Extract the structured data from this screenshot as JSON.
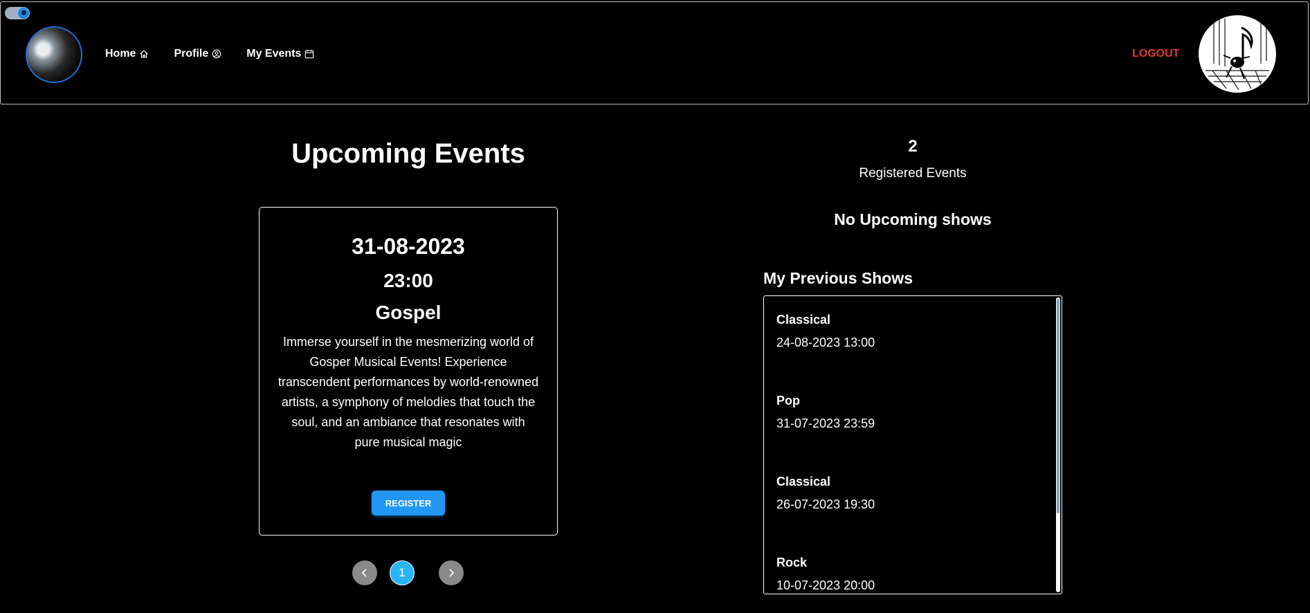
{
  "header": {
    "nav": [
      {
        "label": "Home",
        "icon": "home-icon"
      },
      {
        "label": "Profile",
        "icon": "user-circle-icon"
      },
      {
        "label": "My Events",
        "icon": "calendar-icon"
      }
    ],
    "logout_label": "LOGOUT",
    "colors": {
      "logout": "#e53935",
      "accent": "#1e88e5"
    }
  },
  "upcoming": {
    "title": "Upcoming Events",
    "event": {
      "date": "31-08-2023",
      "time": "23:00",
      "genre": "Gospel",
      "description": "Immerse yourself in the mesmerizing world of Gosper Musical Events! Experience transcendent performances by world-renowned artists, a symphony of melodies that touch the soul, and an ambiance that resonates with pure musical magic",
      "register_label": "REGISTER"
    },
    "pagination": {
      "current_page": "1"
    }
  },
  "stats": {
    "registered_count": "2",
    "registered_label": "Registered Events",
    "no_upcoming": "No Upcoming shows"
  },
  "previous": {
    "title": "My Previous Shows",
    "items": [
      {
        "genre": "Classical",
        "when": "24-08-2023 13:00"
      },
      {
        "genre": "Pop",
        "when": "31-07-2023 23:59"
      },
      {
        "genre": "Classical",
        "when": "26-07-2023 19:30"
      },
      {
        "genre": "Rock",
        "when": "10-07-2023 20:00"
      }
    ]
  }
}
